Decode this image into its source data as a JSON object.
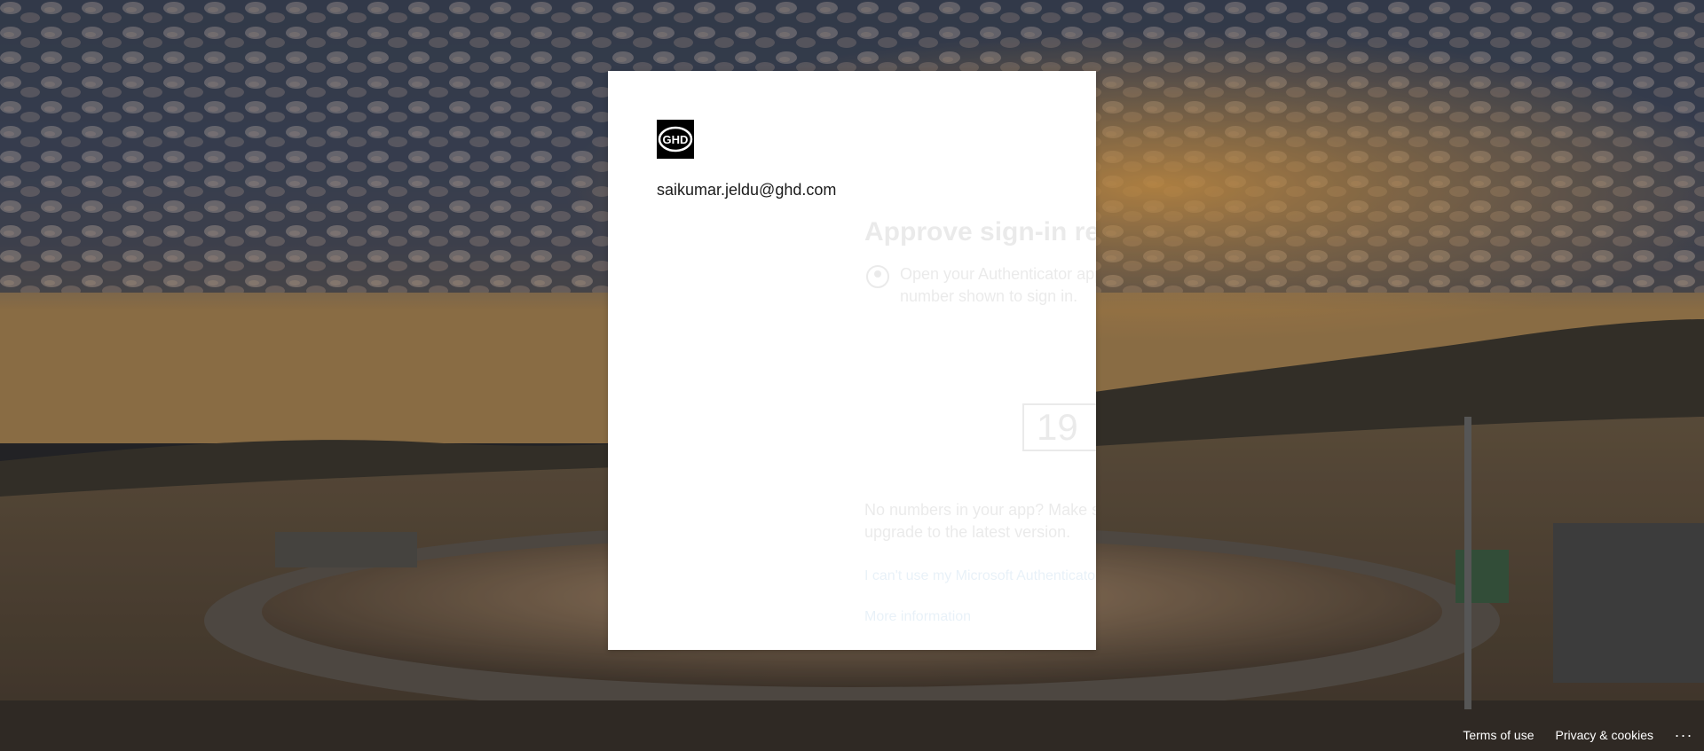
{
  "card": {
    "logo_text": "GHD",
    "identity": "saikumar.jeldu@ghd.com"
  },
  "next_pane": {
    "title": "Approve sign-in request",
    "instruction": "Open your Authenticator app, and enter the number shown to sign in.",
    "number": "19",
    "help": "No numbers in your app? Make sure to upgrade to the latest version.",
    "cant_use_link": "I can't use my Microsoft Authenticator app right now",
    "more_info_link": "More information"
  },
  "footer": {
    "terms": "Terms of use",
    "privacy": "Privacy & cookies",
    "more": "..."
  },
  "colors": {
    "card_bg": "#ffffff",
    "link": "#0067b8",
    "text": "#1b1b1b"
  }
}
